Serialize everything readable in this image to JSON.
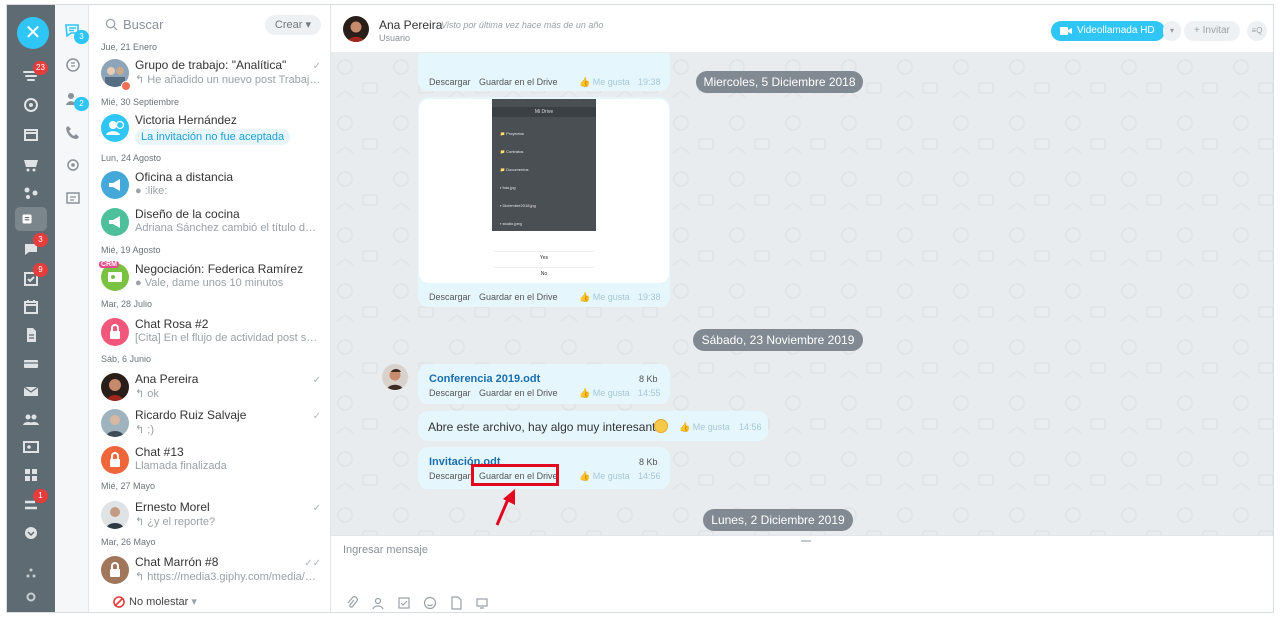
{
  "rail": {
    "badges": {
      "notifications": "23",
      "chats": "3",
      "tasks": "9",
      "other": "1",
      "col2_chat": "3",
      "col2_open": "2"
    }
  },
  "list": {
    "search_placeholder": "Buscar",
    "crear_label": "Crear",
    "groups": [
      {
        "date": "Jue, 21 Enero",
        "items": [
          {
            "name": "Grupo de trabajo: \"Analítica\"",
            "last": "He añadido un nuevo post Trabajo…"
          }
        ]
      },
      {
        "date": "Mié, 30 Septiembre",
        "items": [
          {
            "name": "Victoria Hernández",
            "last": "La invitación no fue aceptada"
          }
        ]
      },
      {
        "date": "Lun, 24 Agosto",
        "items": [
          {
            "name": "Oficina a distancia",
            "last": ":like:"
          },
          {
            "name": "Diseño de la cocina",
            "last": "Adriana Sánchez cambió el título del …"
          }
        ]
      },
      {
        "date": "Mié, 19 Agosto",
        "items": [
          {
            "name": "Negociación: Federica Ramírez",
            "last": "Vale, dame unos 10 minutos",
            "badge": "CRM"
          }
        ]
      },
      {
        "date": "Mar, 28 Julio",
        "items": [
          {
            "name": "Chat Rosa #2",
            "last": "[Cita] En el flujo de actividad post se …"
          }
        ]
      },
      {
        "date": "Sáb, 6 Junio",
        "items": [
          {
            "name": "Ana Pereira",
            "last": "ok"
          },
          {
            "name": "Ricardo Ruiz Salvaje",
            "last": ";)"
          },
          {
            "name": "Chat #13",
            "last": "Llamada finalizada"
          }
        ]
      },
      {
        "date": "Mié, 27 Mayo",
        "items": [
          {
            "name": "Ernesto Morel",
            "last": "¿y el reporte?"
          }
        ]
      },
      {
        "date": "Mar, 26 Mayo",
        "items": [
          {
            "name": "Chat Marrón #8",
            "last": "https://media3.giphy.com/media/7…"
          }
        ]
      }
    ],
    "no_molestar": "No molestar"
  },
  "header": {
    "name": "Ana Pereira",
    "status": "Visto por última vez hace más de un año",
    "role": "Usuario",
    "video_btn": "Videollamada HD",
    "invite_btn": "Invitar",
    "search_btn": "≡Q"
  },
  "messages": {
    "download": "Descargar",
    "save_drive": "Guardar en el Drive",
    "like": "Me gusta",
    "dates": [
      "Miercoles, 5 Diciembre 2018",
      "Sábado, 23 Noviembre 2019",
      "Lunes, 2 Diciembre 2019"
    ],
    "times": [
      "19:38",
      "19:38",
      "14:55",
      "14:56",
      "14:56"
    ],
    "file1": {
      "name": "Conferencia 2019.odt",
      "size": "8 Kb"
    },
    "text_msg": "Abre este archivo, hay algo muy interesante",
    "file2": {
      "name": "Invitación.odt",
      "size": "8 Kb"
    },
    "phone": {
      "title": "Mi Drive",
      "items": [
        "Proyectos",
        "Contratos",
        "Documentos",
        "foto.jpg",
        "Diciembre2018.jpg",
        "studio.jpeg"
      ],
      "yes": "Yes",
      "no": "No"
    }
  },
  "composer": {
    "placeholder": "Ingresar mensaje"
  },
  "colors": {
    "accent": "#2fc6f6",
    "rail": "#5f6b73",
    "highlight": "#e2081e",
    "bubble": "#e6f6fd"
  }
}
